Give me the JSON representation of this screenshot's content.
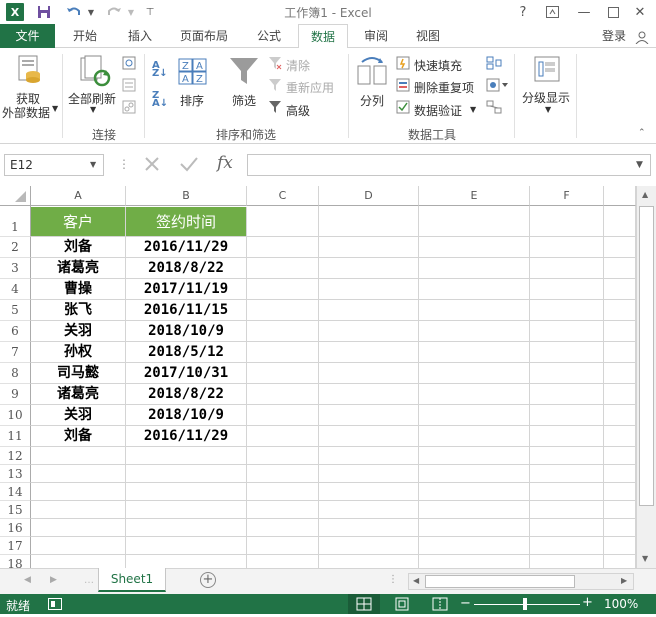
{
  "window": {
    "title": "工作簿1 - Excel"
  },
  "quick_access": {
    "save": "save-icon",
    "undo": "undo-icon",
    "redo": "redo-icon"
  },
  "window_controls": {
    "help": "?",
    "minimize": "—",
    "close": "✕"
  },
  "tabs": [
    {
      "label": "文件"
    },
    {
      "label": "开始"
    },
    {
      "label": "插入"
    },
    {
      "label": "页面布局"
    },
    {
      "label": "公式"
    },
    {
      "label": "数据"
    },
    {
      "label": "审阅"
    },
    {
      "label": "视图"
    }
  ],
  "account": {
    "label": "登录"
  },
  "ribbon": {
    "get_external": {
      "line1": "获取",
      "line2": "外部数据"
    },
    "refresh_all": {
      "label": "全部刷新"
    },
    "group_connections": "连接",
    "sort": {
      "label": "排序"
    },
    "filter": {
      "label": "筛选"
    },
    "clear": {
      "label": "清除"
    },
    "reapply": {
      "label": "重新应用"
    },
    "advanced": {
      "label": "高级"
    },
    "group_sort_filter": "排序和筛选",
    "text_to_columns": {
      "label": "分列"
    },
    "flash_fill": {
      "label": "快速填充"
    },
    "remove_duplicates": {
      "label": "删除重复项"
    },
    "data_validation": {
      "label": "数据验证"
    },
    "group_data_tools": "数据工具",
    "outline": {
      "label": "分级显示"
    }
  },
  "formula_bar": {
    "name_box": "E12",
    "fx": "fx",
    "value": ""
  },
  "sheet": {
    "columns": [
      "A",
      "B",
      "C",
      "D",
      "E",
      "F"
    ],
    "rows": [
      "1",
      "2",
      "3",
      "4",
      "5",
      "6",
      "7",
      "8",
      "9",
      "10",
      "11",
      "12",
      "13",
      "14",
      "15",
      "16",
      "17",
      "18"
    ],
    "header": [
      "客户",
      "签约时间"
    ],
    "data": [
      [
        "刘备",
        "2016/11/29"
      ],
      [
        "诸葛亮",
        "2018/8/22"
      ],
      [
        "曹操",
        "2017/11/19"
      ],
      [
        "张飞",
        "2016/11/15"
      ],
      [
        "关羽",
        "2018/10/9"
      ],
      [
        "孙权",
        "2018/5/12"
      ],
      [
        "司马懿",
        "2017/10/31"
      ],
      [
        "诸葛亮",
        "2018/8/22"
      ],
      [
        "关羽",
        "2018/10/9"
      ],
      [
        "刘备",
        "2016/11/29"
      ]
    ]
  },
  "sheet_tabs": [
    {
      "label": "Sheet1"
    }
  ],
  "status": {
    "ready": "就绪",
    "zoom": "100%"
  },
  "colors": {
    "excel_green": "#217346",
    "header_fill": "#70ad47"
  }
}
